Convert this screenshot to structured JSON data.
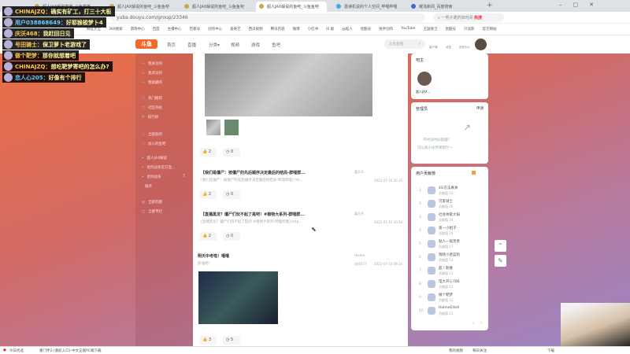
{
  "browser": {
    "tabs": [
      "超人JAX解说直播_斗鱼直播",
      "超人JAX解说的鱼吧_斗鱼鱼吧",
      "超人JAX解说的鱼吧_斗鱼鱼吧",
      "超人JAX解说的鱼吧_斗鱼鱼吧",
      "嘉读机说的个人空间_哔哩哔哩",
      "曜浅新闻_百度搜索"
    ],
    "url": "yuba.douyu.com/group/23346",
    "search_placeholder": "一男子遭挤掉时间",
    "hot_label": "热搜",
    "bookmarks": [
      "网址大全",
      "360搜索",
      "游戏中心",
      "百度",
      "主播中心",
      "百家号",
      "创作中心",
      "爱奇艺",
      "西瓜视频",
      "腾讯内容",
      "微博",
      "小红书",
      "i6 剧",
      "@超人",
      "优酷号",
      "快手创作",
      "YouTube",
      "王国保卫",
      "优酷号",
      "只读影",
      "官方网站"
    ]
  },
  "site": {
    "logo": "斗鱼",
    "nav": [
      "首页",
      "直播",
      "分类▾",
      "视频",
      "游戏",
      "鱼吧"
    ],
    "search_placeholder": "斗鱼直播",
    "header_icons": [
      "客户端",
      "消息",
      "创作中心"
    ]
  },
  "sidebar": {
    "items": [
      "我关注的",
      "我浏览的",
      "我收藏的",
      "热门推荐",
      "社区热帖",
      "排行榜",
      "全部鱼吧",
      "加入的鱼吧",
      "超人JAX解说",
      "星际战争官方直...",
      "星际战争",
      "展开",
      "全部话题",
      "全部专栏"
    ],
    "counts": {
      "星际战争官方直...": "65",
      "星际战争": "7"
    }
  },
  "posts": [
    {
      "title": "",
      "sub": "",
      "likes": "2",
      "comments": "0"
    },
    {
      "title": "【我们是僵尸：按僵尸的先后顺序决定最后的结局-群哩群...",
      "sub": "[我们是僵尸：按僵尸的先后顺序决定最后的结局-哔哩哔哩] htt...",
      "author": "嘉天开...",
      "time": "2022-07-10 20:35",
      "likes": "2",
      "comments": "0"
    },
    {
      "title": "【直播黑龙？僵尸们玩不起了是吧！#植物大系列-群哩群...",
      "sub": "[直播黑龙？僵尸们玩不起了是吧 #植物大系列-哔哩哔哩] http...",
      "author": "嘉天开...",
      "time": "2022-07-10 20:34",
      "likes": "2",
      "comments": "0"
    },
    {
      "title": "明天中考啦！嘻嘻",
      "sub": "加油吧!",
      "author": "Holme...",
      "views": "浏览537",
      "time": "2022-07-10 09:34",
      "likes": "3",
      "comments": "5"
    }
  ],
  "host_card": {
    "title": "吧主",
    "name": "超人JAX..."
  },
  "admin_card": {
    "title": "管理员",
    "apply": "申请",
    "empty_line1": "平时没时间管理？",
    "empty_line2": "可以找小伙伴来帮忙～"
  },
  "ranking": {
    "title": "用户贡献榜",
    "page_prev": "‹",
    "page_next": "›",
    "items": [
      {
        "rank": "1",
        "name": "4G方法真帅",
        "score": "贡献值 53"
      },
      {
        "rank": "2",
        "name": "可爱骑士",
        "score": "贡献值 36"
      },
      {
        "rank": "3",
        "name": "社会帅家大锅",
        "score": "贡献值 34"
      },
      {
        "rank": "4",
        "name": "第一小姐子",
        "score": "贡献值 19"
      },
      {
        "rank": "5",
        "name": "贴人一般贵贵",
        "score": "贡献值 17"
      },
      {
        "rank": "6",
        "name": "晓晓小爸蓝狗",
        "score": "贡献值 14"
      },
      {
        "rank": "7",
        "name": "超 / 斯维",
        "score": "贡献值 13"
      },
      {
        "rank": "8",
        "name": "电大开心786",
        "score": "贡献值 12"
      },
      {
        "rank": "9",
        "name": "做个靶梦",
        "score": "贡献值 12"
      },
      {
        "rank": "10",
        "name": "HolmeEllish",
        "score": "贡献值 11"
      }
    ]
  },
  "chat": [
    {
      "user": "CHINAJZQ：",
      "msg": "确实有矿工，打三十大板"
    },
    {
      "user": "用户038868649：",
      "msg": "好耶猴梭梦卜4"
    },
    {
      "user": "庆沃468：",
      "msg": "我赶回日见"
    },
    {
      "user": "号田骑士：",
      "msg": "保卫萝卜老游戏了"
    },
    {
      "user": "做个靶梦：",
      "msg": "那你就想着吧"
    },
    {
      "user": "CHINAJZQ：",
      "msg": "想吃靶梦寄吧的怎么办?"
    },
    {
      "user": "恋人心205：",
      "msg": "好像有个排行"
    }
  ],
  "status": {
    "left": "今日优选",
    "news": "重门伴2-(重航入口)-中文正版PC端下载",
    "right": [
      "我的视频",
      "每日关注",
      "下载"
    ]
  }
}
